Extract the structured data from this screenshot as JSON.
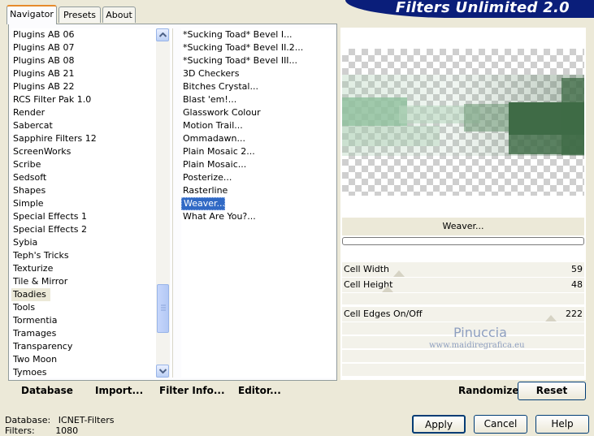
{
  "title": "Filters Unlimited 2.0",
  "tabs": [
    {
      "label": "Navigator"
    },
    {
      "label": "Presets"
    },
    {
      "label": "About"
    }
  ],
  "categories": [
    "Plugins AB 06",
    "Plugins AB 07",
    "Plugins AB 08",
    "Plugins AB 21",
    "Plugins AB 22",
    "RCS Filter Pak 1.0",
    "Render",
    "Sabercat",
    "Sapphire Filters 12",
    "ScreenWorks",
    "Scribe",
    "Sedsoft",
    "Shapes",
    "Simple",
    "Special Effects 1",
    "Special Effects 2",
    "Sybia",
    "Teph's Tricks",
    "Texturize",
    "Tile & Mirror",
    "Toadies",
    "Tools",
    "Tormentia",
    "Tramages",
    "Transparency",
    "Two Moon",
    "Tymoes"
  ],
  "filters": [
    "*Sucking Toad*  Bevel I...",
    "*Sucking Toad*  Bevel II.2...",
    "*Sucking Toad*  Bevel III...",
    "3D Checkers",
    "Bitches Crystal...",
    "Blast 'em!...",
    "Glasswork Colour",
    "Motion Trail...",
    "Ommadawn...",
    "Plain Mosaic 2...",
    "Plain Mosaic...",
    "Posterize...",
    "Rasterline",
    "Weaver...",
    "What Are You?..."
  ],
  "current_filter": "Weaver...",
  "params": [
    {
      "label": "Cell Width",
      "value": "59"
    },
    {
      "label": "Cell Height",
      "value": "48"
    },
    {
      "label": "Cell Edges On/Off",
      "value": "222"
    }
  ],
  "watermark": {
    "name": "Pinuccia",
    "url": "www.maidiregrafica.eu"
  },
  "buttons": {
    "database": "Database",
    "import": "Import...",
    "filter_info": "Filter Info...",
    "editor": "Editor...",
    "randomize": "Randomize",
    "reset": "Reset",
    "apply": "Apply",
    "cancel": "Cancel",
    "help": "Help"
  },
  "status": {
    "database_label": "Database:",
    "database_value": "ICNET-Filters",
    "filters_label": "Filters:",
    "filters_value": "1080"
  },
  "colors": {
    "selection": "#316ac5",
    "banner": "#0a1e7a",
    "preview_green": "#3f6b46"
  }
}
